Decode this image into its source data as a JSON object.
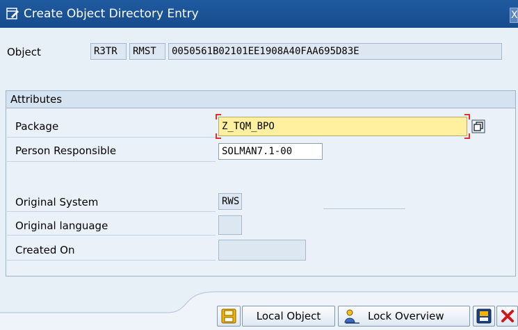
{
  "window": {
    "title": "Create Object Directory Entry",
    "close_glyph": "X"
  },
  "object": {
    "label": "Object",
    "pgmid": "R3TR",
    "type": "RMST",
    "name": "0050561B02101EE1908A40FAA695D83E"
  },
  "attributes": {
    "heading": "Attributes",
    "package_label": "Package",
    "package_value": "Z_TQM_BPO",
    "person_label": "Person Responsible",
    "person_value": "SOLMAN7.1-00",
    "orig_system_label": "Original System",
    "orig_system_value": "RWS",
    "orig_lang_label": "Original language",
    "orig_lang_value": "",
    "created_label": "Created On",
    "created_value": ""
  },
  "buttons": {
    "save_icon": "save-icon",
    "local_object": "Local Object",
    "lock_overview": "Lock Overview",
    "cancel_icon": "cancel-icon"
  },
  "colors": {
    "titlebar": "#1f5aa0",
    "required_marker": "#e0302a",
    "package_field_bg": "#fff0a0"
  }
}
